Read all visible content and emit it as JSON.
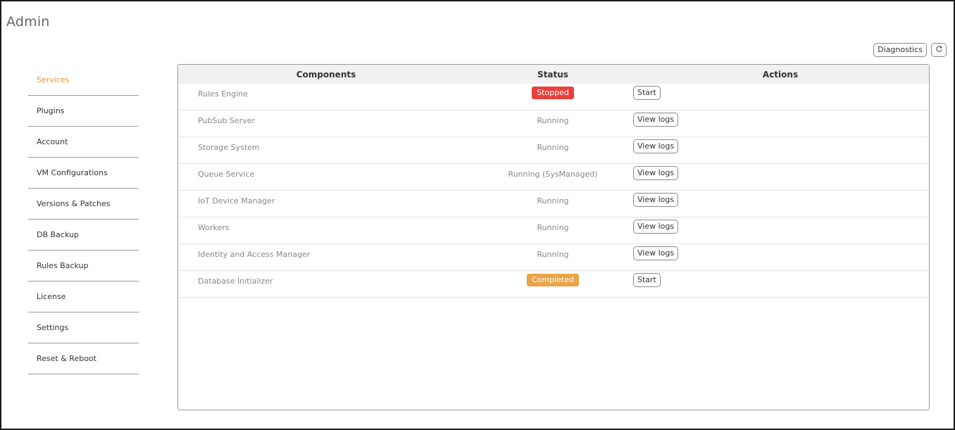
{
  "page": {
    "title": "Admin"
  },
  "toolbar": {
    "diagnostics_label": "Diagnostics",
    "refresh_icon": "refresh-icon"
  },
  "sidebar": {
    "items": [
      {
        "label": "Services",
        "active": true
      },
      {
        "label": "Plugins"
      },
      {
        "label": "Account"
      },
      {
        "label": "VM Configurations"
      },
      {
        "label": "Versions & Patches"
      },
      {
        "label": "DB Backup"
      },
      {
        "label": "Rules Backup"
      },
      {
        "label": "License"
      },
      {
        "label": "Settings"
      },
      {
        "label": "Reset & Reboot"
      }
    ]
  },
  "table": {
    "headers": {
      "components": "Components",
      "status": "Status",
      "actions": "Actions"
    },
    "rows": [
      {
        "component": "Rules Engine",
        "status": "Stopped",
        "status_style": "badge-red",
        "action": "Start"
      },
      {
        "component": "PubSub Server",
        "status": "Running",
        "action": "View logs"
      },
      {
        "component": "Storage System",
        "status": "Running",
        "action": "View logs"
      },
      {
        "component": "Queue Service",
        "status": "Running (SysManaged)",
        "action": "View logs"
      },
      {
        "component": "IoT Device Manager",
        "status": "Running",
        "action": "View logs"
      },
      {
        "component": "Workers",
        "status": "Running",
        "action": "View logs"
      },
      {
        "component": "Identity and Access Manager",
        "status": "Running",
        "action": "View logs"
      },
      {
        "component": "Database Initializer",
        "status": "Completed",
        "status_style": "badge-orange",
        "action": "Start"
      }
    ]
  },
  "colors": {
    "accent": "#f0932b",
    "stopped": "#e8413c",
    "completed": "#eaa346"
  }
}
